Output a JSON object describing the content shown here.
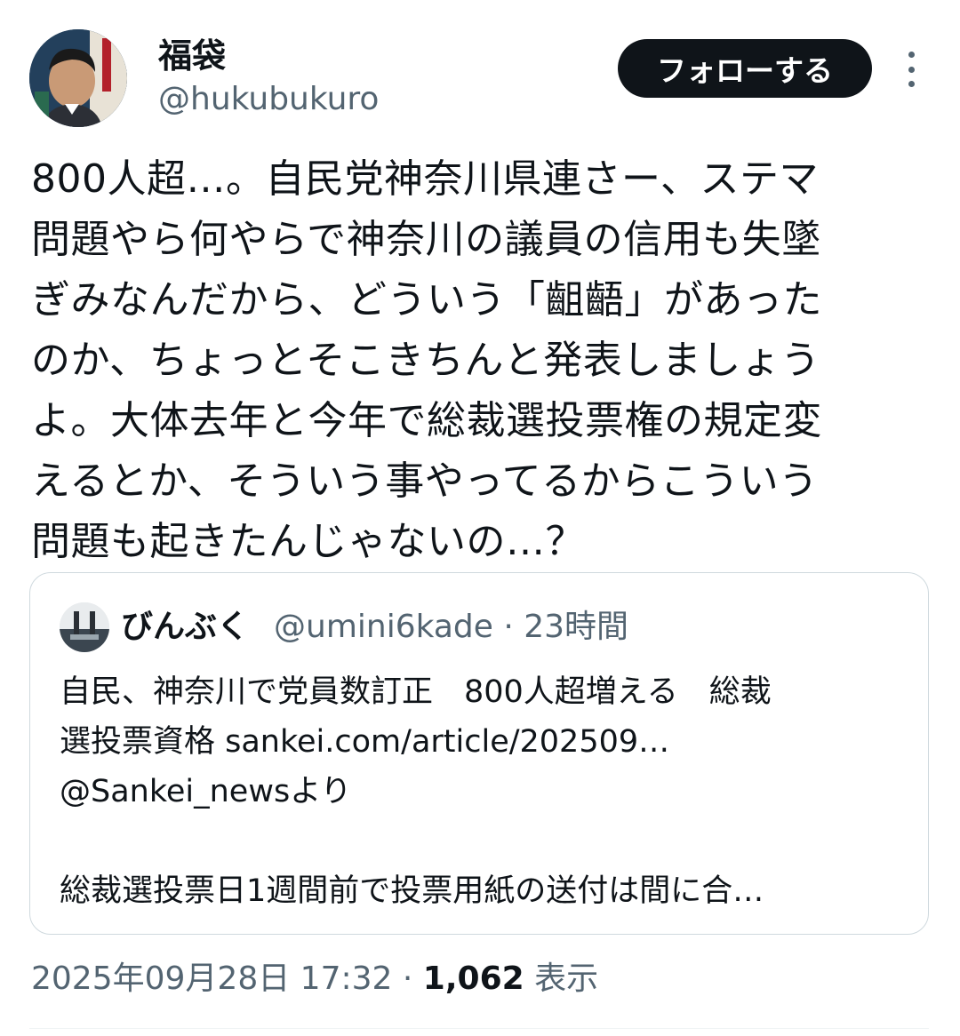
{
  "tweet": {
    "author": {
      "display_name": "福袋",
      "handle": "@hukubukuro"
    },
    "follow_label": "フォローする",
    "text_lines": [
      "800人超…。自民党神奈川県連さー、ステマ",
      "問題やら何やらで神奈川の議員の信用も失墜",
      "ぎみなんだから、どういう「齟齬」があった",
      "のか、ちょっとそこきちんと発表しましょう",
      "よ。大体去年と今年で総裁選投票権の規定変",
      "えるとか、そういう事やってるからこういう",
      "問題も起きたんじゃないの…？"
    ],
    "timestamp": "2025年09月28日 17:32",
    "separator": "·",
    "views_count": "1,062",
    "views_label": "表示"
  },
  "quoted": {
    "display_name": "びんぶく",
    "handle": "@umini6kade",
    "separator": "·",
    "time": "23時間",
    "text_lines": [
      "自民、神奈川で党員数訂正　800人超増える　総裁",
      "選投票資格 sankei.com/article/202509…",
      "@Sankei_newsより",
      "",
      "総裁選投票日1週間前で投票用紙の送付は間に合…"
    ]
  },
  "icons": {
    "more": "more-horizontal-icon"
  }
}
